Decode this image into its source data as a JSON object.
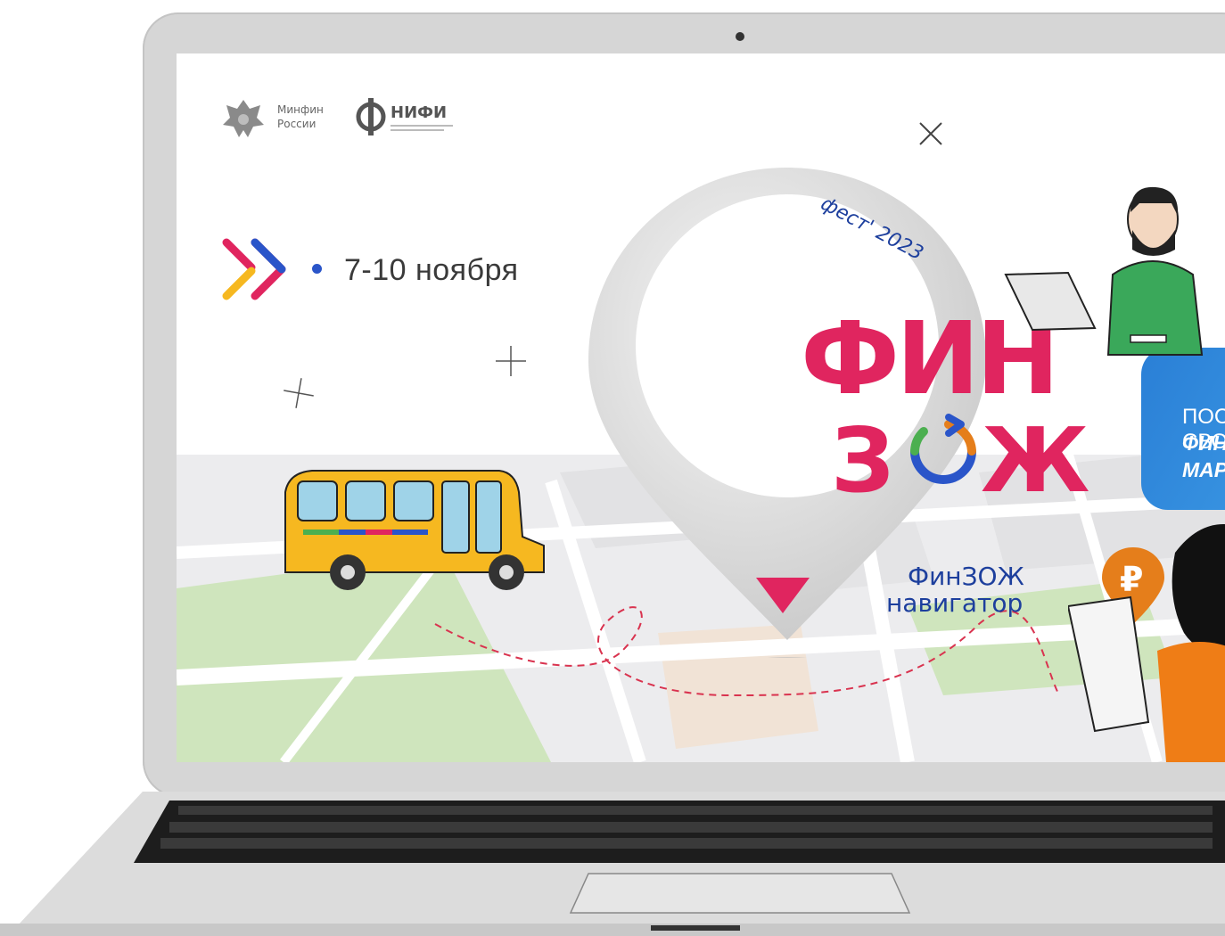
{
  "colors": {
    "brand_pink": "#e0255f",
    "brand_blue": "#1d3f9d",
    "cta_blue": "#2a7fd6",
    "bus_yellow": "#f6b820",
    "map_green": "#cfe5bd",
    "map_gray": "#e8e8ea",
    "route_red": "#d9334f",
    "ruble_orange": "#e57e1b"
  },
  "header": {
    "minfin_line1": "Минфин",
    "minfin_line2": "России",
    "nifi_title": "НИФИ"
  },
  "event": {
    "date": "7-10 ноября",
    "fest_label": "фест' 2023",
    "title_line1": "ФИН",
    "title_line2_a": "З",
    "title_line2_b": "Ж",
    "subtitle_line1": "ФинЗОЖ",
    "subtitle_line2": "навигатор"
  },
  "cta": {
    "line1": "ПОСТРОЙ СВОЙ",
    "line2": "ФИНАНСОВЫЙ",
    "line3": "МАРШРУТ"
  },
  "ruble_symbol": "₽",
  "icons": {
    "close": "close-icon",
    "plus": "plus-icon",
    "chevrons": "double-chevron-icon",
    "emblem": "emblem-icon"
  }
}
